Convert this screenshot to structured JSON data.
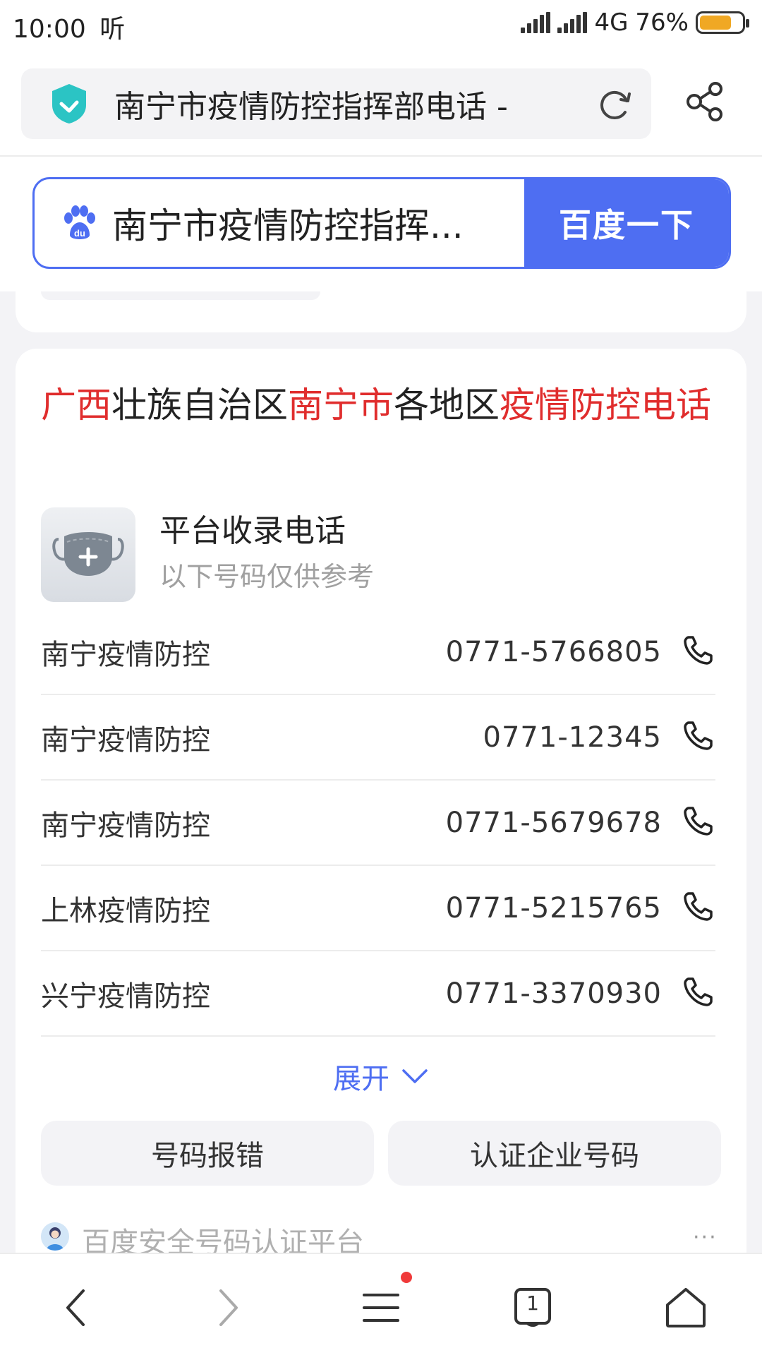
{
  "status_bar": {
    "time": "10:00",
    "hd_listen": "听",
    "network": "4G",
    "battery_percent": "76%",
    "battery_level": 0.76,
    "battery_color": "#f0a824"
  },
  "address_bar": {
    "title": "南宁市疫情防控指挥部电话 -",
    "shield_color": "#2bc4c4"
  },
  "search": {
    "query": "南宁市疫情防控指挥...",
    "button_label": "百度一下",
    "accent": "#4e6ef2"
  },
  "card": {
    "title_parts": [
      {
        "text": "广西",
        "highlight": true
      },
      {
        "text": "壮族自治区",
        "highlight": false
      },
      {
        "text": "南宁市",
        "highlight": true
      },
      {
        "text": "各地区",
        "highlight": false
      },
      {
        "text": "疫情防控电话",
        "highlight": true
      }
    ],
    "highlight_color": "#e02d2d",
    "platform_title": "平台收录电话",
    "platform_subtitle": "以下号码仅供参考",
    "rows": [
      {
        "name": "南宁疫情防控",
        "phone": "0771-5766805"
      },
      {
        "name": "南宁疫情防控",
        "phone": "0771-12345"
      },
      {
        "name": "南宁疫情防控",
        "phone": "0771-5679678"
      },
      {
        "name": "上林疫情防控",
        "phone": "0771-5215765"
      },
      {
        "name": "兴宁疫情防控",
        "phone": "0771-3370930"
      }
    ],
    "expand_label": "展开",
    "report_button": "号码报错",
    "cert_button": "认证企业号码",
    "footer_text": "百度安全号码认证平台",
    "more_label": "···"
  },
  "bottom_nav": {
    "back_icon": "chevron-left-icon",
    "forward_icon": "chevron-right-icon",
    "menu_icon": "menu-icon",
    "tabs_count": "1",
    "home_icon": "home-icon"
  }
}
